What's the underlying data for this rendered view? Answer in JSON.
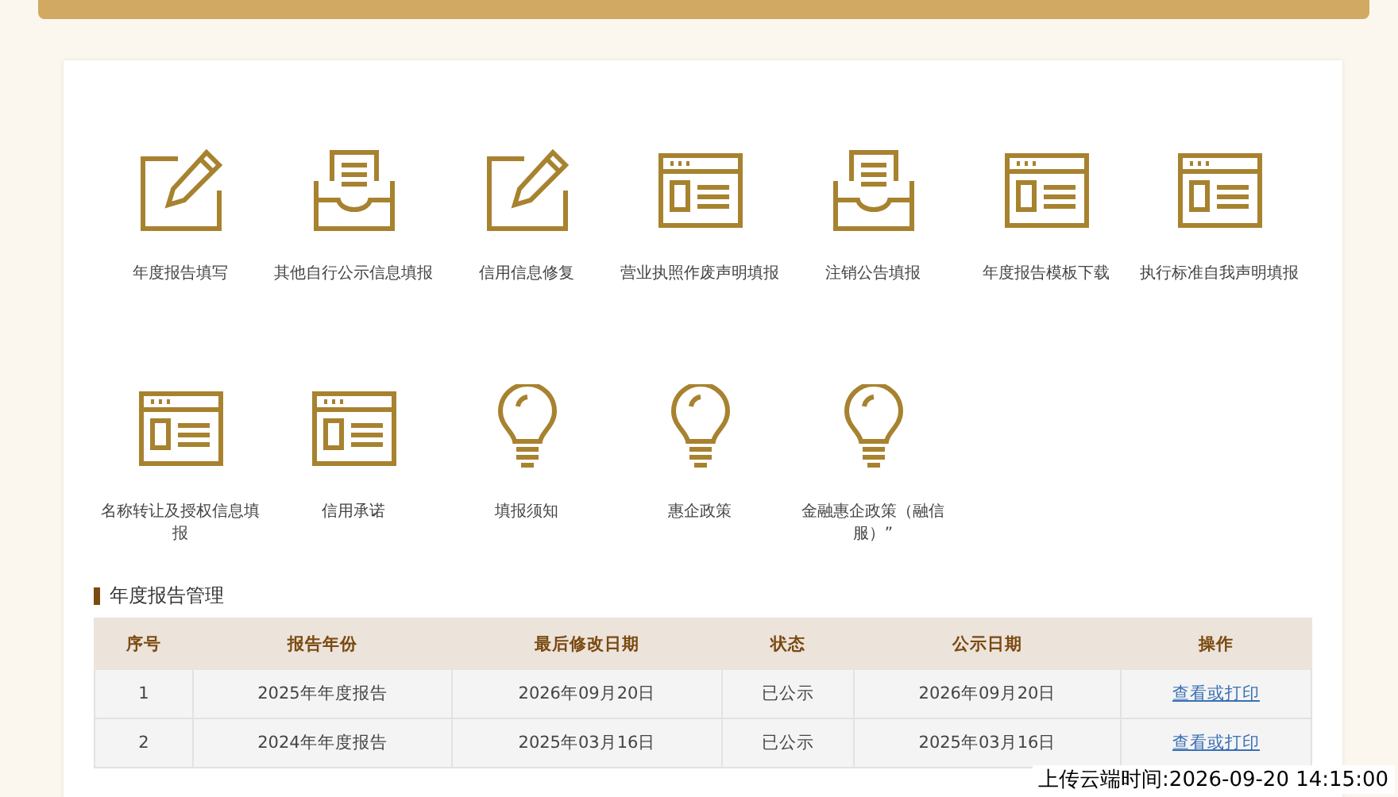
{
  "services": [
    {
      "label": "年度报告填写",
      "kind": "pencil"
    },
    {
      "label": "其他自行公示信息填报",
      "kind": "tray"
    },
    {
      "label": "信用信息修复",
      "kind": "pencil"
    },
    {
      "label": "营业执照作废声明填报",
      "kind": "form"
    },
    {
      "label": "注销公告填报",
      "kind": "tray"
    },
    {
      "label": "年度报告模板下载",
      "kind": "form"
    },
    {
      "label": "执行标准自我声明填报",
      "kind": "form"
    },
    {
      "label": "名称转让及授权信息填报",
      "kind": "form"
    },
    {
      "label": "信用承诺",
      "kind": "form"
    },
    {
      "label": "填报须知",
      "kind": "bulb"
    },
    {
      "label": "惠企政策",
      "kind": "bulb"
    },
    {
      "label": "金融惠企政策（融信服）”",
      "kind": "bulb"
    }
  ],
  "section_title": "年度报告管理",
  "table": {
    "columns": [
      "序号",
      "报告年份",
      "最后修改日期",
      "状态",
      "公示日期",
      "操作"
    ],
    "rows": [
      {
        "cells": [
          "1",
          "2025年年度报告",
          "2026年09月20日",
          "已公示",
          "2026年09月20日"
        ],
        "action": "查看或打印"
      },
      {
        "cells": [
          "2",
          "2024年年度报告",
          "2025年03月16日",
          "已公示",
          "2025年03月16日"
        ],
        "action": "查看或打印"
      }
    ]
  },
  "upload_time": "上传云端时间:2026-09-20 14:15:00"
}
